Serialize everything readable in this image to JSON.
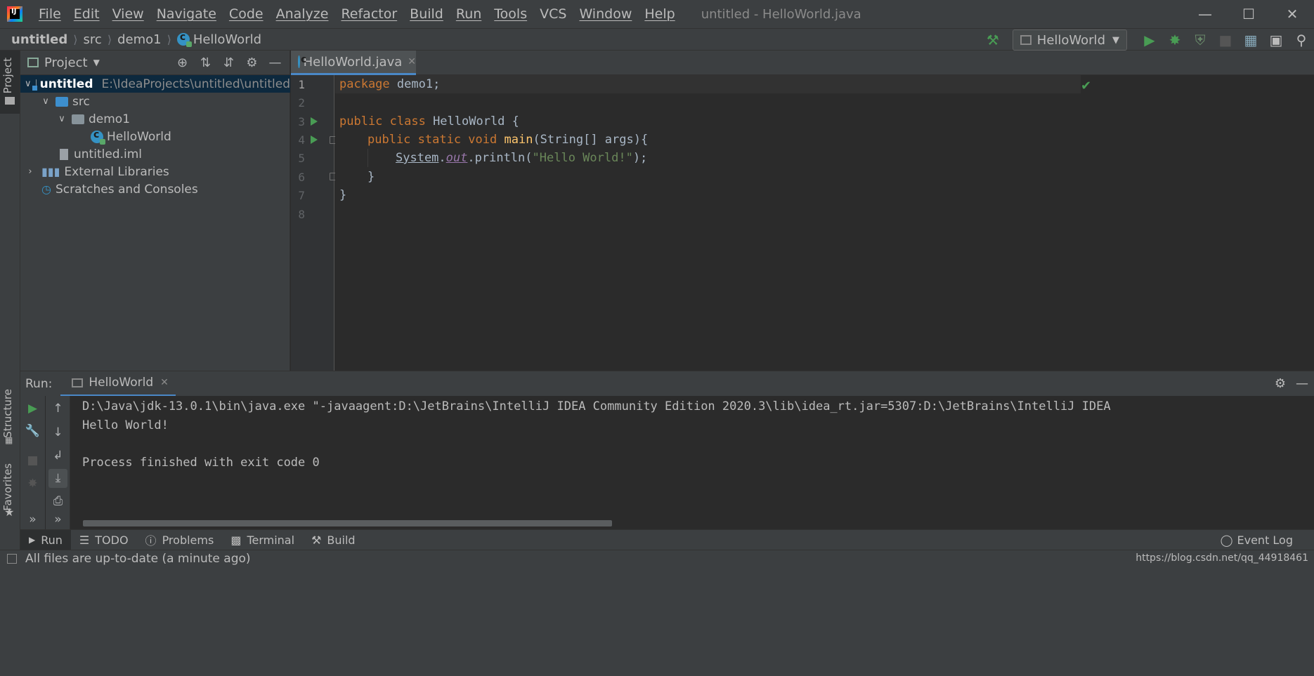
{
  "titlebar": {
    "menu": [
      "File",
      "Edit",
      "View",
      "Navigate",
      "Code",
      "Analyze",
      "Refactor",
      "Build",
      "Run",
      "Tools",
      "VCS",
      "Window",
      "Help"
    ],
    "window_title": "untitled - HelloWorld.java"
  },
  "navbar": {
    "crumbs": [
      "untitled",
      "src",
      "demo1",
      "HelloWorld"
    ],
    "run_config": "HelloWorld"
  },
  "left_strip": {
    "top_tab": "Project",
    "structure_tab": "Structure",
    "favorites_tab": "Favorites"
  },
  "project": {
    "header": "Project",
    "tree": [
      {
        "label": "untitled",
        "path": "E:\\IdeaProjects\\untitled\\untitled"
      },
      {
        "label": "src"
      },
      {
        "label": "demo1"
      },
      {
        "label": "HelloWorld"
      },
      {
        "label": "untitled.iml"
      },
      {
        "label": "External Libraries"
      },
      {
        "label": "Scratches and Consoles"
      }
    ]
  },
  "editor": {
    "tab": "HelloWorld.java",
    "line_numbers": [
      "1",
      "2",
      "3",
      "4",
      "5",
      "6",
      "7",
      "8"
    ],
    "code": {
      "l1_kw": "package",
      "l1_rest": " demo1;",
      "l3_kw": "public class",
      "l3_rest": " HelloWorld {",
      "l4_kw": "public static void",
      "l4_fn": "main",
      "l4_rest": "(String[] args){",
      "l5_sys": "System",
      "l5_dot": ".",
      "l5_out": "out",
      "l5_call": ".println(",
      "l5_str": "\"Hello World!\"",
      "l5_end": ");",
      "l6": "}",
      "l7": "}"
    }
  },
  "run_panel": {
    "label": "Run:",
    "tab": "HelloWorld",
    "console": [
      "D:\\Java\\jdk-13.0.1\\bin\\java.exe \"-javaagent:D:\\JetBrains\\IntelliJ IDEA Community Edition 2020.3\\lib\\idea_rt.jar=5307:D:\\JetBrains\\IntelliJ IDEA",
      "Hello World!",
      "",
      "Process finished with exit code 0"
    ]
  },
  "bottom_tabs": [
    "Run",
    "TODO",
    "Problems",
    "Terminal",
    "Build"
  ],
  "event_log": "Event Log",
  "status": {
    "message": "All files are up-to-date (a minute ago)",
    "watermark": "https://blog.csdn.net/qq_44918461"
  },
  "colors": {
    "accent": "#4a88c7",
    "run_green": "#499c54",
    "keyword": "#cc7832",
    "string": "#6a8759"
  }
}
